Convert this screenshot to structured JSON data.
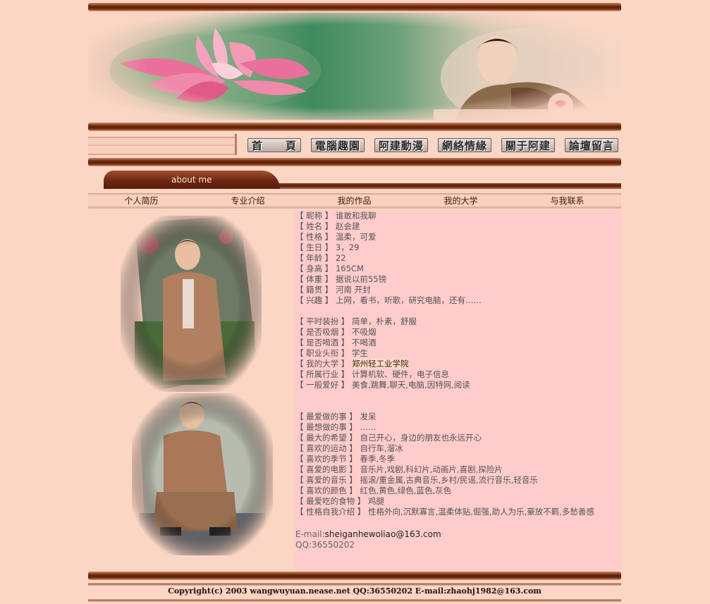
{
  "nav": {
    "items": [
      "首　　頁",
      "電腦趣園",
      "阿建動漫",
      "網絡情緣",
      "關于阿建",
      "論壇留言"
    ]
  },
  "section_tab": "about me",
  "subnav": [
    "个人简历",
    "专业介绍",
    "我的作品",
    "我的大学",
    "与我联系"
  ],
  "profile": [
    {
      "k": "【 昵称 】",
      "v": "谁敢和我聊"
    },
    {
      "k": "【 姓名 】",
      "v": "赵会建"
    },
    {
      "k": "【 性格 】",
      "v": "温柔，可爱"
    },
    {
      "k": "【 生日 】",
      "v": "3，29"
    },
    {
      "k": "【 年龄 】",
      "v": "22"
    },
    {
      "k": "【 身高 】",
      "v": "165CM"
    },
    {
      "k": "【 体重 】",
      "v": "据说以前55镑"
    },
    {
      "k": "【 籍贯 】",
      "v": "河南 开封"
    },
    {
      "k": "【 兴趣 】",
      "v": "上网，看书，听歌，研究电脑，还有……"
    },
    {
      "gap": true
    },
    {
      "k": "【 平时装扮 】",
      "v": "简单，朴素，舒服"
    },
    {
      "k": "【 是否吸烟 】",
      "v": "不吸烟"
    },
    {
      "k": "【 是否喝酒 】",
      "v": "不喝酒"
    },
    {
      "k": "【 职业头衔 】",
      "v": "学生"
    },
    {
      "k": "【 我的大学 】",
      "v": "郑州轻工业学院",
      "hl": true
    },
    {
      "k": "【 所属行业 】",
      "v": "计算机软、硬件，电子信息"
    },
    {
      "k": "【 一般爱好 】",
      "v": "美食,跳舞,聊天,电脑,因特网,阅读"
    },
    {
      "gap2": true
    },
    {
      "k": "【 最爱做的事 】",
      "v": "发呆"
    },
    {
      "k": "【 最想做的事 】",
      "v": "……"
    },
    {
      "k": "【 最大的希望 】",
      "v": "自己开心，身边的朋友也永远开心"
    },
    {
      "k": "【 喜欢的运动 】",
      "v": "自行车,溜冰"
    },
    {
      "k": "【 喜欢的季节 】",
      "v": "春季,冬季"
    },
    {
      "k": "【 喜爱的电影 】",
      "v": "音乐片,戏剧,科幻片,动画片,喜剧,探险片"
    },
    {
      "k": "【 喜爱的音乐 】",
      "v": "摇滚/重金属,古典音乐,乡村/民谣,流行音乐,轻音乐"
    },
    {
      "k": "【 喜欢的颜色 】",
      "v": "红色,黄色,绿色,蓝色,灰色"
    },
    {
      "k": "【 最爱吃的食物 】",
      "v": "鸡腿"
    },
    {
      "k": "【 性格自我介绍 】",
      "v": "性格外向,沉默寡言,温柔体贴,倔强,助人为乐,豪放不羁,多愁善感"
    }
  ],
  "contact": {
    "email_label": "E-mail:",
    "email": "sheiganhewoliao@163.com",
    "qq": "QQ:36550202"
  },
  "footer": "Copyright(c) 2003 wangwuyuan.nease.net QQ:36550202 E-mail:zhaohj1982@163.com",
  "colors": {
    "page_bg": "#FBD6C4",
    "info_bg": "#FFCCCC",
    "bar_brown": "#5A1E08"
  }
}
